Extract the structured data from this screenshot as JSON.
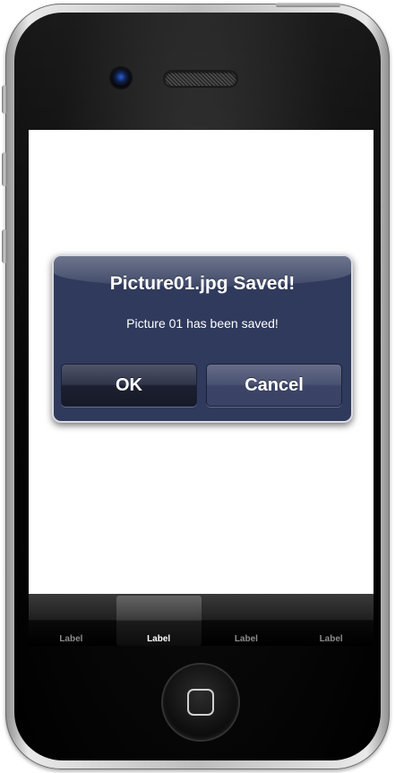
{
  "alert": {
    "title": "Picture01.jpg Saved!",
    "message": "Picture 01 has been saved!",
    "ok_label": "OK",
    "cancel_label": "Cancel"
  },
  "tabbar": {
    "items": [
      {
        "label": "Label",
        "selected": false
      },
      {
        "label": "Label",
        "selected": true
      },
      {
        "label": "Label",
        "selected": false
      },
      {
        "label": "Label",
        "selected": false
      }
    ]
  },
  "colors": {
    "alert_background": "#2f3a5c",
    "alert_border": "#d8dbe3",
    "screen_background": "#ffffff",
    "tabbar_background": "#1f1f1f"
  }
}
